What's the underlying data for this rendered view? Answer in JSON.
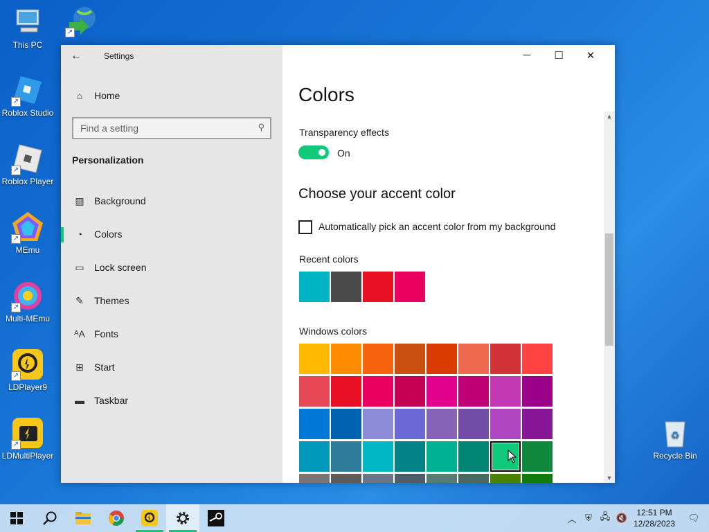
{
  "desktop": {
    "icons": [
      {
        "label": "This PC"
      },
      {
        "label": "Internet Download Manager"
      },
      {
        "label": "Roblox Studio"
      },
      {
        "label": "Roblox Player"
      },
      {
        "label": "MEmu"
      },
      {
        "label": "Multi-MEmu"
      },
      {
        "label": "LDPlayer9"
      },
      {
        "label": "LDMultiPlayer"
      },
      {
        "label": "Recycle Bin"
      }
    ]
  },
  "window": {
    "app_title": "Settings",
    "back_icon": "back-arrow-icon",
    "controls": {
      "minimize": "─",
      "maximize": "☐",
      "close": "✕"
    }
  },
  "sidebar": {
    "home_label": "Home",
    "search_placeholder": "Find a setting",
    "section": "Personalization",
    "items": [
      {
        "label": "Background",
        "icon": "picture-icon",
        "glyph": "▨"
      },
      {
        "label": "Colors",
        "icon": "palette-icon",
        "glyph": "◔",
        "active": true
      },
      {
        "label": "Lock screen",
        "icon": "monitor-icon",
        "glyph": "▭"
      },
      {
        "label": "Themes",
        "icon": "brush-icon",
        "glyph": "✎"
      },
      {
        "label": "Fonts",
        "icon": "fonts-icon",
        "glyph": "ᴬA"
      },
      {
        "label": "Start",
        "icon": "start-grid-icon",
        "glyph": "⊞"
      },
      {
        "label": "Taskbar",
        "icon": "taskbar-icon",
        "glyph": "▬"
      }
    ]
  },
  "main": {
    "title": "Colors",
    "transparency_label": "Transparency effects",
    "transparency_state": "On",
    "accent_heading": "Choose your accent color",
    "auto_pick_label": "Automatically pick an accent color from my background",
    "recent_label": "Recent colors",
    "recent_colors": [
      "#00b4c4",
      "#4a4a4a",
      "#e81123",
      "#ea005e"
    ],
    "windows_label": "Windows colors",
    "windows_colors": [
      [
        "#ffb900",
        "#ff8c00",
        "#f7630c",
        "#ca5010",
        "#da3b01",
        "#ef6950",
        "#d13438",
        "#ff4343"
      ],
      [
        "#e74856",
        "#e81123",
        "#ea005e",
        "#c30052",
        "#e3008c",
        "#bf0077",
        "#c239b3",
        "#9a0089"
      ],
      [
        "#0078d7",
        "#0063b1",
        "#8e8cd8",
        "#6b69d6",
        "#8764b8",
        "#744da9",
        "#b146c2",
        "#881798"
      ],
      [
        "#0099bc",
        "#2d7d9a",
        "#00b7c3",
        "#038387",
        "#00b294",
        "#018574",
        "#11c97a",
        "#10893e"
      ],
      [
        "#7a7574",
        "#5d5a58",
        "#68768a",
        "#515c6b",
        "#567c73",
        "#486860",
        "#498205",
        "#107c10"
      ]
    ],
    "selected_color": "#11c97a"
  },
  "taskbar": {
    "apps": [
      {
        "name": "start-button"
      },
      {
        "name": "search-button"
      },
      {
        "name": "file-explorer"
      },
      {
        "name": "chrome"
      },
      {
        "name": "ldplayer"
      },
      {
        "name": "settings"
      },
      {
        "name": "steam"
      }
    ],
    "time": "12:51 PM",
    "date": "12/28/2023"
  }
}
